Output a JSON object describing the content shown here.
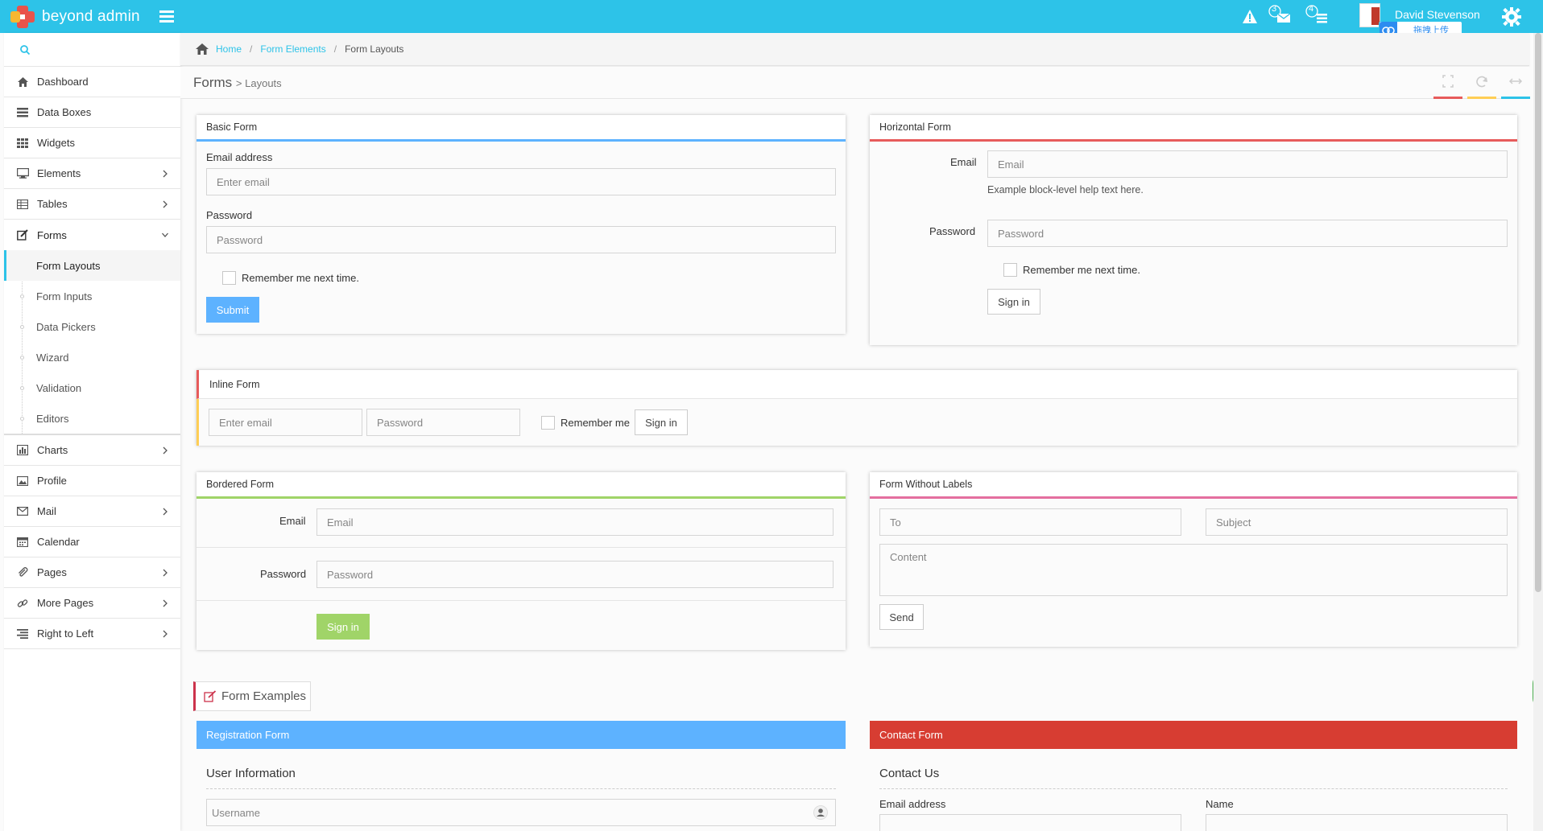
{
  "navbar": {
    "brand": "beyond admin",
    "user_name": "David Stevenson",
    "upload_label": "拖拽上传",
    "mail_count": "3",
    "tasks_count": "4"
  },
  "sidebar": {
    "search_placeholder": "",
    "items": [
      {
        "label": "Dashboard",
        "icon": "home-icon"
      },
      {
        "label": "Data Boxes",
        "icon": "data-boxes-icon"
      },
      {
        "label": "Widgets",
        "icon": "grid-icon"
      },
      {
        "label": "Elements",
        "icon": "desktop-icon"
      },
      {
        "label": "Tables",
        "icon": "table-icon"
      },
      {
        "label": "Forms",
        "icon": "edit-icon"
      }
    ],
    "forms_sub": [
      "Form Layouts",
      "Form Inputs",
      "Data Pickers",
      "Wizard",
      "Validation",
      "Editors"
    ],
    "items2": [
      {
        "label": "Charts",
        "icon": "bar-chart-icon"
      },
      {
        "label": "Profile",
        "icon": "picture-icon"
      },
      {
        "label": "Mail",
        "icon": "envelope-icon"
      },
      {
        "label": "Calendar",
        "icon": "calendar-icon"
      },
      {
        "label": "Pages",
        "icon": "paperclip-icon"
      },
      {
        "label": "More Pages",
        "icon": "link-icon"
      },
      {
        "label": "Right to Left",
        "icon": "align-right-icon"
      }
    ]
  },
  "breadcrumb": {
    "home": "Home",
    "form_elements": "Form Elements",
    "current": "Form Layouts"
  },
  "page_header": {
    "title": "Forms",
    "subtitle": "Layouts"
  },
  "basic_form": {
    "title": "Basic Form",
    "email_label": "Email address",
    "email_placeholder": "Enter email",
    "password_label": "Password",
    "password_placeholder": "Password",
    "remember_label": "Remember me next time.",
    "submit": "Submit"
  },
  "horizontal_form": {
    "title": "Horizontal Form",
    "email_label": "Email",
    "email_placeholder": "Email",
    "help_text": "Example block-level help text here.",
    "password_label": "Password",
    "password_placeholder": "Password",
    "remember_label": "Remember me next time.",
    "signin": "Sign in"
  },
  "inline_form": {
    "title": "Inline Form",
    "email_placeholder": "Enter email",
    "password_placeholder": "Password",
    "remember_label": "Remember me",
    "signin": "Sign in"
  },
  "bordered_form": {
    "title": "Bordered Form",
    "email_label": "Email",
    "email_placeholder": "Email",
    "password_label": "Password",
    "password_placeholder": "Password",
    "signin": "Sign in"
  },
  "no_labels_form": {
    "title": "Form Without Labels",
    "to_placeholder": "To",
    "subject_placeholder": "Subject",
    "content_placeholder": "Content",
    "send": "Send"
  },
  "form_examples": {
    "tab_label": "Form Examples"
  },
  "registration_form": {
    "title": "Registration Form",
    "section": "User Information",
    "username_placeholder": "Username"
  },
  "contact_form": {
    "title": "Contact Form",
    "section": "Contact Us",
    "email_label": "Email address",
    "name_label": "Name"
  },
  "colors": {
    "navbar": "#2dc3e8",
    "blue": "#5db2ff",
    "red": "#e75b5b",
    "yellow": "#ffce55",
    "green": "#a0d468",
    "pink": "#e46f9f",
    "contact_red": "#d73d32"
  }
}
